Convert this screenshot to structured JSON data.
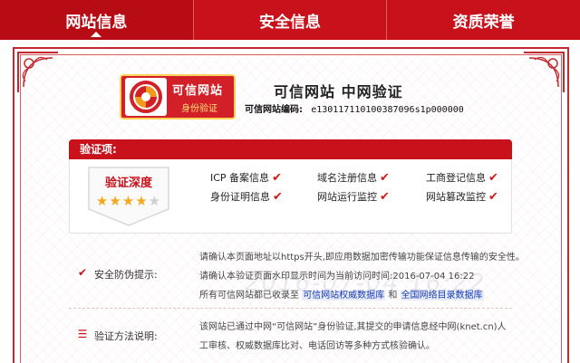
{
  "tabs": [
    {
      "label": "网站信息",
      "active": true
    },
    {
      "label": "安全信息",
      "active": false
    },
    {
      "label": "资质荣誉",
      "active": false
    }
  ],
  "header": {
    "logo_title": "可信网站",
    "logo_subtitle": "身份验证",
    "title": "可信网站  中网验证",
    "code_label": "可信网站编码:",
    "code_value": "e1301171101003870​96s1p000000"
  },
  "verification": {
    "section_label": "验证项:",
    "badge_label": "验证深度",
    "stars": 4,
    "stars_max": 5,
    "items": [
      {
        "label": "ICP 备案信息"
      },
      {
        "label": "域名注册信息"
      },
      {
        "label": "工商登记信息"
      },
      {
        "label": "身份证明信息"
      },
      {
        "label": "网站运行监控"
      },
      {
        "label": "网站篡改监控"
      }
    ]
  },
  "security_tip": {
    "label": "安全防伪提示:",
    "line1": "请确认本页面地址以https开头,即应用数据加密传输功能保证信息传输的安全性。",
    "line2": "请确认本验证页面水印显示时间为当前访问时间:2016-07-04 16:22",
    "line3_prefix": "所有可信网站都已收录至",
    "link1": "可信网站权威数据库",
    "line3_and": "和",
    "link2": "全国网络目录数据库",
    "watermark": "2016-07-04 16:22"
  },
  "method": {
    "label": "验证方法说明:",
    "line1": "该网站已通过中网“可信网站”身份验证,其提交的申请信息经中网(knet.cn)人",
    "line2": "工审核、权威数据库比对、电话回访等多种方式核验确认。"
  },
  "colors": {
    "brand_red": "#c8111b",
    "star_gold": "#f3a81b",
    "link_blue": "#1a3cb4"
  }
}
